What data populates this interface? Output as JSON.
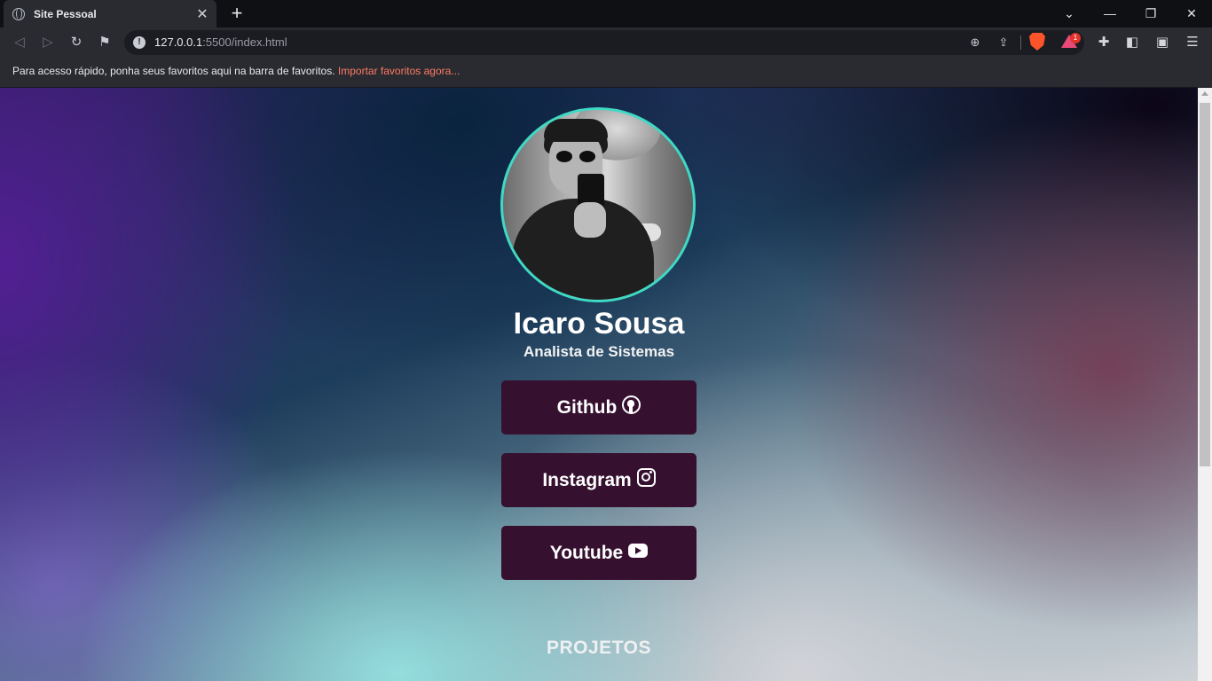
{
  "browser": {
    "tab": {
      "title": "Site Pessoal",
      "icon": "globe-icon",
      "close": "✕"
    },
    "new_tab": "+",
    "window_controls": {
      "tab_search": "⌄",
      "minimize": "—",
      "restore": "❐",
      "close": "✕"
    },
    "address": {
      "host": "127.0.0.1",
      "rest": ":5500/index.html"
    },
    "rewards_badge": "1",
    "bookmarks_bar": {
      "message": "Para acesso rápido, ponha seus favoritos aqui na barra de favoritos.",
      "import_link": "Importar favoritos agora..."
    },
    "colors": {
      "tab_strip": "#0f1014",
      "toolbar": "#2a2b31",
      "link": "#ff7b63"
    }
  },
  "profile": {
    "name": "Icaro Sousa",
    "role": "Analista de Sistemas",
    "avatar_border_color": "#3fd9c4"
  },
  "links": [
    {
      "label": "Github",
      "icon": "github-icon"
    },
    {
      "label": "Instagram",
      "icon": "instagram-icon"
    },
    {
      "label": "Youtube",
      "icon": "youtube-icon"
    }
  ],
  "button_color": "#35102f",
  "section": {
    "title": "PROJETOS"
  }
}
